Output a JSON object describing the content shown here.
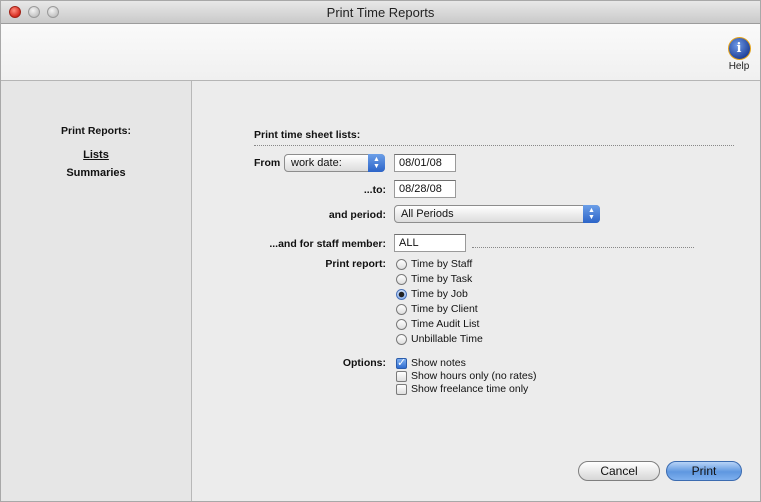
{
  "window": {
    "title": "Print Time Reports"
  },
  "toolbar": {
    "help_label": "Help",
    "help_icon": "info-icon",
    "help_glyph": "i"
  },
  "sidebar": {
    "title": "Print Reports:",
    "items": [
      {
        "label": "Lists",
        "selected": true
      },
      {
        "label": "Summaries",
        "selected": false
      }
    ]
  },
  "form": {
    "heading": "Print time sheet lists:",
    "from_label": "From",
    "date_type": "work date:",
    "from_date": "08/01/08",
    "to_label": "...to:",
    "to_date": "08/28/08",
    "period_label": "and period:",
    "period_value": "All Periods",
    "staff_label": "...and for staff member:",
    "staff_value": "ALL",
    "report_label": "Print report:",
    "reports": [
      {
        "label": "Time by Staff",
        "selected": false
      },
      {
        "label": "Time by Task",
        "selected": false
      },
      {
        "label": "Time by Job",
        "selected": true
      },
      {
        "label": "Time by Client",
        "selected": false
      },
      {
        "label": "Time Audit List",
        "selected": false
      },
      {
        "label": "Unbillable Time",
        "selected": false
      }
    ],
    "options_label": "Options:",
    "options": [
      {
        "label": "Show notes",
        "checked": true
      },
      {
        "label": "Show hours only (no rates)",
        "checked": false
      },
      {
        "label": "Show freelance time only",
        "checked": false
      }
    ]
  },
  "buttons": {
    "cancel": "Cancel",
    "print": "Print"
  },
  "colors": {
    "accent": "#2c64c8",
    "close": "#d62a1e"
  }
}
